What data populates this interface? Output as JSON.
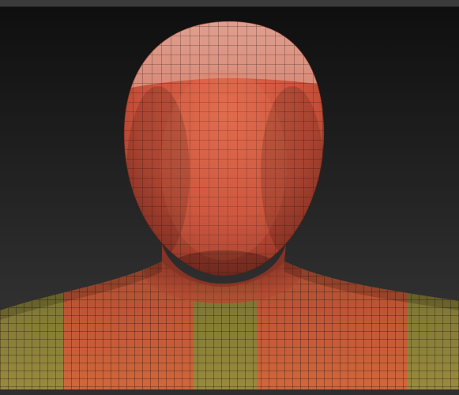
{
  "viewport": {
    "label": "",
    "background_top": "#0f0f0f",
    "background_bottom": "#3a3a3a"
  },
  "model": {
    "subject": "bust",
    "display": "polyframe-wireframe",
    "polygroup_colors": {
      "head": "#c8503a",
      "head_highlight": "#d88a78",
      "neck_shadow": "#7a2a1f",
      "shoulders_orange": "#c85a36",
      "shoulders_green": "#8a7c3a"
    },
    "wire_color": "#2b1712"
  }
}
